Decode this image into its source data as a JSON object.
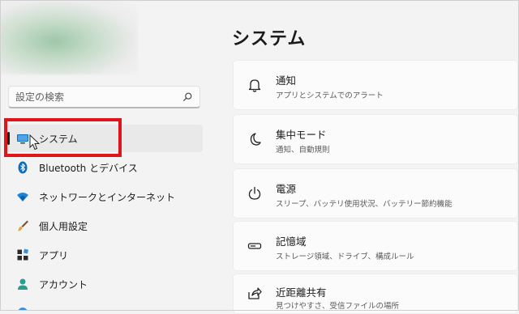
{
  "sidebar": {
    "search": {
      "placeholder": "設定の検索"
    },
    "items": [
      {
        "label": "システム",
        "icon": "monitor-icon",
        "selected": true
      },
      {
        "label": "Bluetooth とデバイス",
        "icon": "bluetooth-icon"
      },
      {
        "label": "ネットワークとインターネット",
        "icon": "wifi-icon"
      },
      {
        "label": "個人用設定",
        "icon": "brush-icon"
      },
      {
        "label": "アプリ",
        "icon": "apps-icon"
      },
      {
        "label": "アカウント",
        "icon": "person-icon"
      }
    ]
  },
  "main": {
    "title": "システム",
    "cards": [
      {
        "title": "通知",
        "subtitle": "アプリとシステムでのアラート",
        "icon": "bell-icon"
      },
      {
        "title": "集中モード",
        "subtitle": "通知、自動規則",
        "icon": "moon-icon"
      },
      {
        "title": "電源",
        "subtitle": "スリープ、バッテリ使用状況、バッテリー節約機能",
        "icon": "power-icon"
      },
      {
        "title": "記憶域",
        "subtitle": "ストレージ領域、ドライブ、構成ルール",
        "icon": "storage-icon"
      },
      {
        "title": "近距離共有",
        "subtitle": "見つけやすさ、受信ファイルの場所",
        "icon": "share-icon"
      }
    ]
  },
  "colors": {
    "accent": "#0067c0",
    "highlight": "#e0151c",
    "background": "#f3f3f3"
  }
}
